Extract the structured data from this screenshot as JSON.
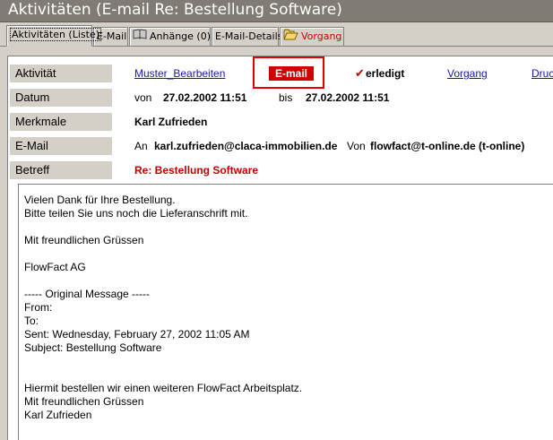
{
  "window": {
    "title": "Aktivitäten (E-mail Re: Bestellung Software)"
  },
  "tabs": [
    {
      "label": "Aktivitäten (Liste)",
      "active": true
    },
    {
      "label": "E-Mail"
    },
    {
      "label": "Anhänge (0)",
      "icon": "book-icon"
    },
    {
      "label": "E-Mail-Details"
    },
    {
      "label": "Vorgang",
      "icon": "folder-icon",
      "color": "#cc0000"
    }
  ],
  "fields": {
    "aktivitaet": {
      "label": "Aktivität",
      "muster_link": "Muster_Bearbeiten",
      "type_badge": "E-mail",
      "status_check": "✔",
      "status": "erledigt",
      "vorgang_link": "Vorgang",
      "druck_link": "Druck"
    },
    "datum": {
      "label": "Datum",
      "von_label": "von",
      "von_value": "27.02.2002 11:51",
      "bis_label": "bis",
      "bis_value": "27.02.2002 11:51"
    },
    "merkmale": {
      "label": "Merkmale",
      "value": "Karl Zufrieden"
    },
    "email": {
      "label": "E-Mail",
      "an_label": "An",
      "an_value": "karl.zufrieden@claca-immobilien.de",
      "von_label": "Von",
      "von_value": "flowfact@t-online.de (t-online)"
    },
    "betreff": {
      "label": "Betreff",
      "value": "Re: Bestellung Software"
    }
  },
  "message": {
    "lines": [
      "Vielen Dank für Ihre Bestellung.",
      "Bitte teilen Sie uns noch die Lieferanschrift mit.",
      "",
      "Mit freundlichen Grüssen",
      "",
      "FlowFact AG",
      "",
      "----- Original Message -----",
      "From:",
      "To:",
      "Sent: Wednesday, February 27, 2002 11:05 AM",
      "Subject: Bestellung Software",
      "",
      "",
      "Hiermit bestellen wir einen weiteren FlowFact Arbeitsplatz.",
      "Mit freundlichen Grüssen",
      "Karl Zufrieden"
    ]
  },
  "colors": {
    "accent_red": "#d00000",
    "link_blue": "#1a1aa6",
    "titlebar": "#807b74"
  }
}
